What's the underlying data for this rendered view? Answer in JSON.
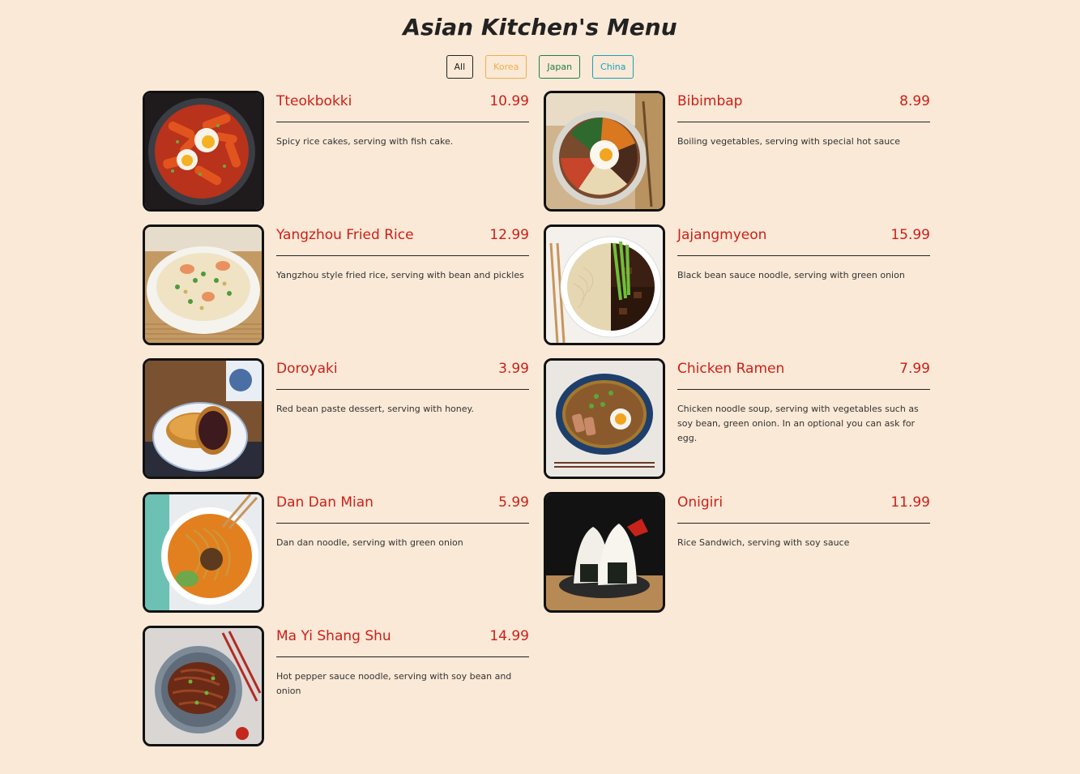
{
  "page": {
    "title": "Asian Kitchen's Menu"
  },
  "filters": [
    {
      "label": "All",
      "color": "#222222"
    },
    {
      "label": "Korea",
      "color": "#f0ad4e"
    },
    {
      "label": "Japan",
      "color": "#1e7e4a"
    },
    {
      "label": "China",
      "color": "#17a2b8"
    }
  ],
  "menu": [
    {
      "name": "Tteokbokki",
      "price": "10.99",
      "desc": "Spicy rice cakes, serving with fish cake.",
      "icon": "tteokbokki-photo"
    },
    {
      "name": "Bibimbap",
      "price": "8.99",
      "desc": "Boiling vegetables, serving with special hot sauce",
      "icon": "bibimbap-photo"
    },
    {
      "name": "Yangzhou Fried Rice",
      "price": "12.99",
      "desc": "Yangzhou style fried rice, serving with bean and pickles",
      "icon": "fried-rice-photo"
    },
    {
      "name": "Jajangmyeon",
      "price": "15.99",
      "desc": "Black bean sauce noodle, serving with green onion",
      "icon": "jajangmyeon-photo"
    },
    {
      "name": "Doroyaki",
      "price": "3.99",
      "desc": "Red bean paste dessert, serving with honey.",
      "icon": "dorayaki-photo"
    },
    {
      "name": "Chicken Ramen",
      "price": "7.99",
      "desc": "Chicken noodle soup, serving with vegetables such as soy bean, green onion. In an optional you can ask for egg.",
      "icon": "ramen-photo"
    },
    {
      "name": "Dan Dan Mian",
      "price": "5.99",
      "desc": "Dan dan noodle, serving with green onion",
      "icon": "dan-dan-mian-photo"
    },
    {
      "name": "Onigiri",
      "price": "11.99",
      "desc": "Rice Sandwich, serving with soy sauce",
      "icon": "onigiri-photo"
    },
    {
      "name": "Ma Yi Shang Shu",
      "price": "14.99",
      "desc": "Hot pepper sauce noodle, serving with soy bean and onion",
      "icon": "ma-yi-shang-shu-photo"
    }
  ]
}
